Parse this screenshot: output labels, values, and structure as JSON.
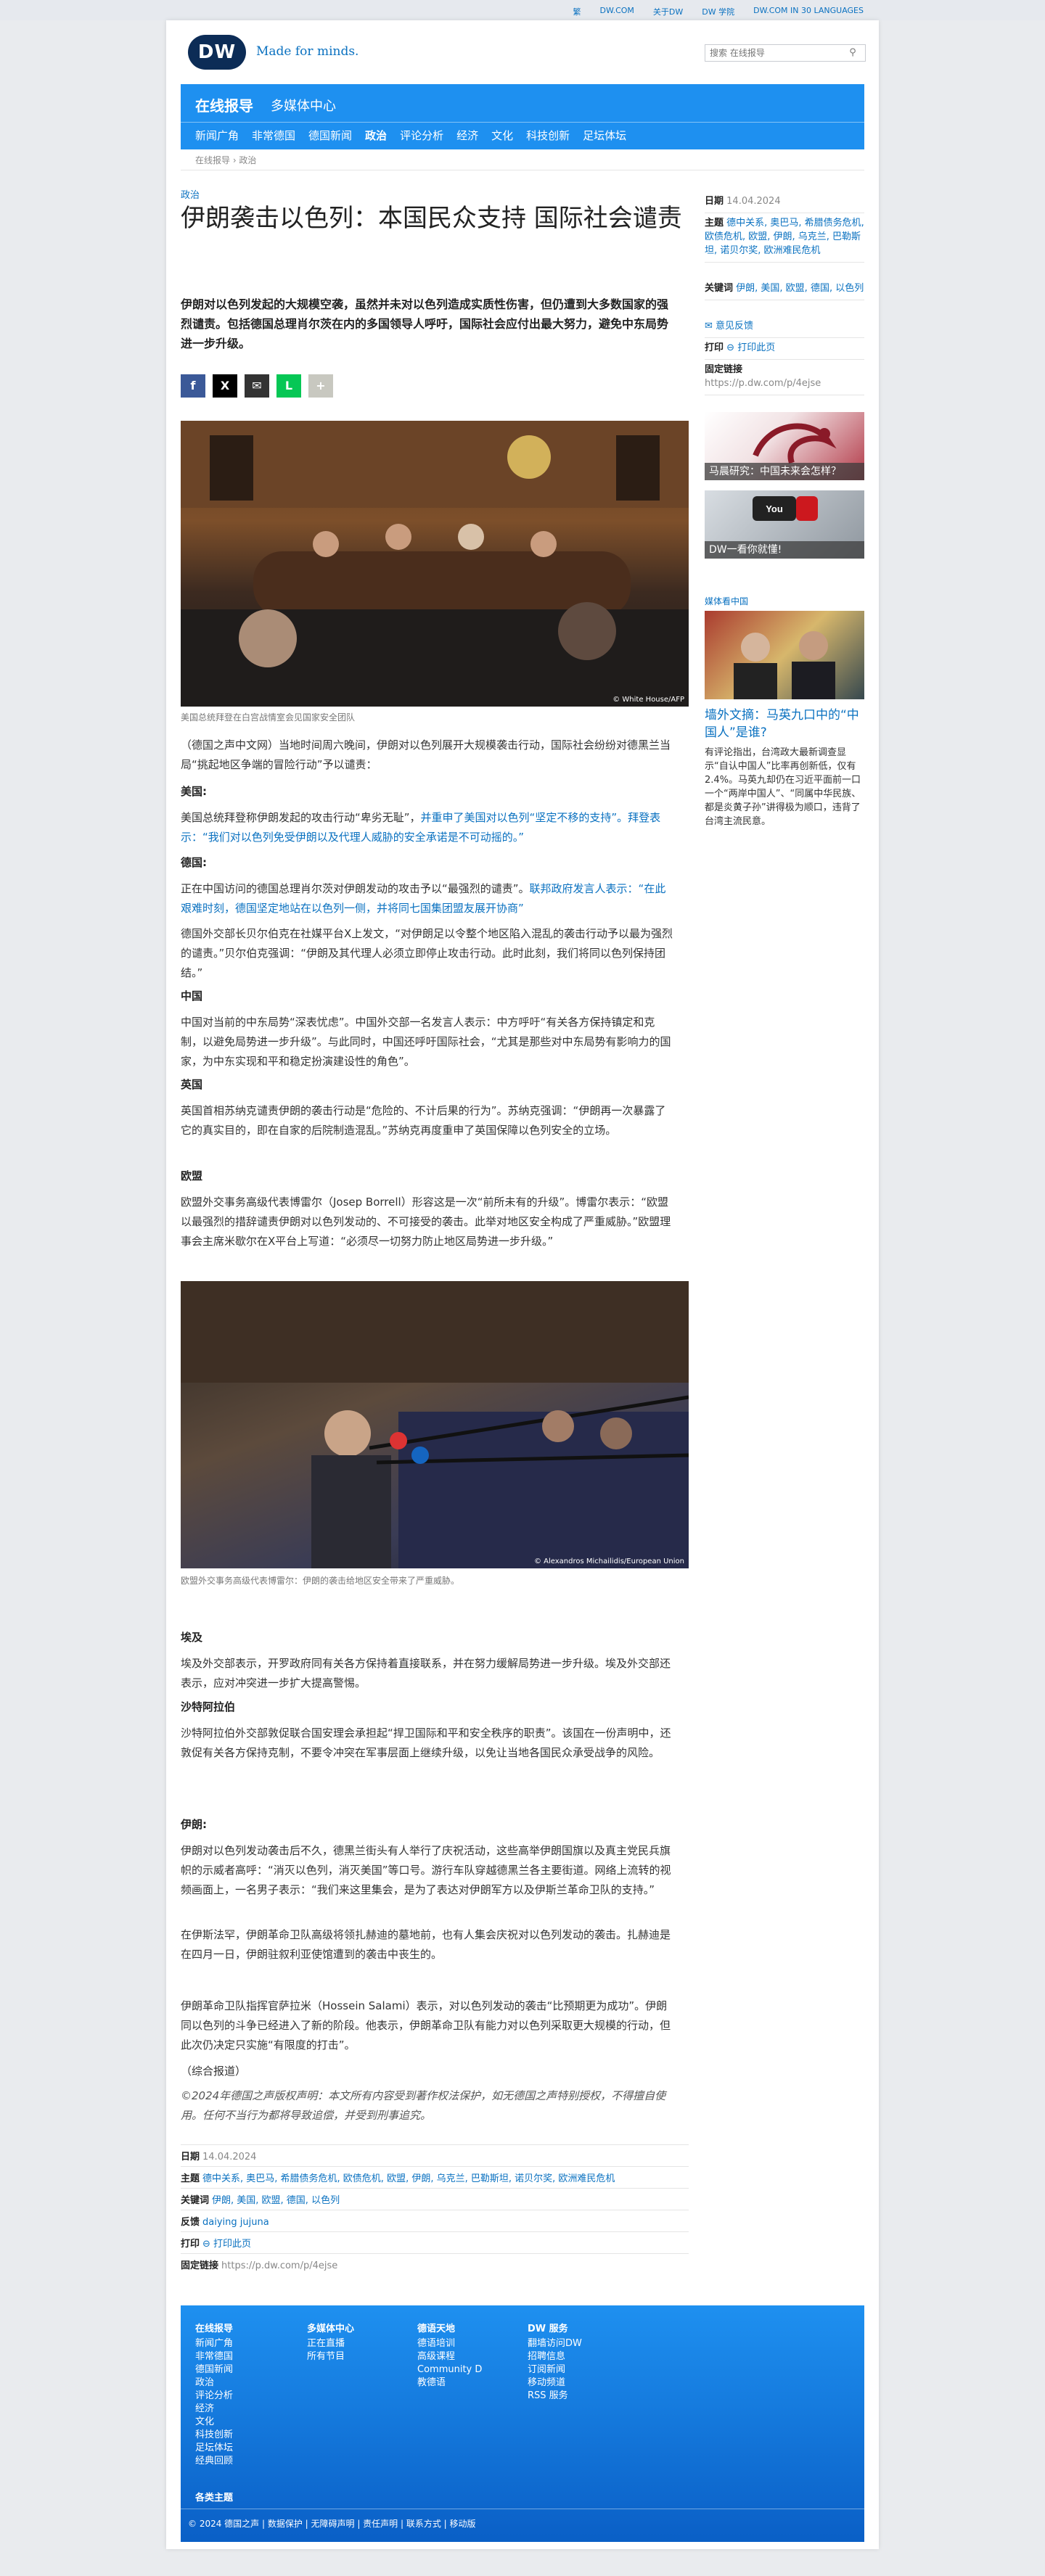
{
  "top_links": [
    "繁",
    "DW.COM",
    "关于DW",
    "DW 学院",
    "DW.COM IN 30 LANGUAGES"
  ],
  "header": {
    "logo": "DW",
    "tagline": "Made for minds.",
    "search_placeholder": "搜索 在线报导"
  },
  "nav": {
    "title": "在线报导",
    "subtitle": "多媒体中心",
    "items": [
      "新闻广角",
      "非常德国",
      "德国新闻",
      "政治",
      "评论分析",
      "经济",
      "文化",
      "科技创新",
      "足坛体坛"
    ],
    "active_index": 3
  },
  "breadcrumb": "在线报导 › 政治",
  "article": {
    "kicker": "政治",
    "headline": "伊朗袭击以色列：本国民众支持 国际社会谴责",
    "lead": "伊朗对以色列发起的大规模空袭，虽然并未对以色列造成实质性伤害，但仍遭到大多数国家的强烈谴责。包括德国总理肖尔茨在内的多国领导人呼吁，国际社会应付出最大努力，避免中东局势进一步升级。",
    "share": [
      "f",
      "X",
      "✉",
      "L",
      "+"
    ],
    "photo1_credit": "© White House/AFP",
    "photo1_caption": "美国总统拜登在白宫战情室会见国家安全团队",
    "p1": "（德国之声中文网）当地时间周六晚间，伊朗对以色列展开大规模袭击行动，国际社会纷纷对德黑兰当局“挑起地区争端的冒险行动”予以谴责：",
    "h_us": "美国:",
    "p_us_a": "美国总统拜登称伊朗发起的攻击行动“卑劣无耻”，",
    "p_us_b": "并重申了美国对以色列“坚定不移的支持”。拜登表示：“我们对以色列免受伊朗以及代理人威胁的安全承诺是不可动摇的。”",
    "h_de": "德国:",
    "p_de_a": "正在中国访问的德国总理肖尔茨对伊朗发动的攻击予以“最强烈的谴责”。",
    "p_de_b": "联邦政府发言人表示：“在此艰难时刻，德国坚定地站在以色列一侧，并将同七国集团盟友展开协商”",
    "p_de2": "德国外交部长贝尔伯克在社媒平台X上发文，“对伊朗足以令整个地区陷入混乱的袭击行动予以最为强烈的谴责。”贝尔伯克强调：“伊朗及其代理人必须立即停止攻击行动。此时此刻，我们将同以色列保持团结。”",
    "h_cn": "中国",
    "p_cn": "中国对当前的中东局势“深表忧虑”。中国外交部一名发言人表示：中方呼吁“有关各方保持镇定和克制，以避免局势进一步升级”。与此同时，中国还呼吁国际社会，“尤其是那些对中东局势有影响力的国家，为中东实现和平和稳定扮演建设性的角色”。",
    "h_uk": "英国",
    "p_uk": "英国首相苏纳克谴责伊朗的袭击行动是“危险的、不计后果的行为”。苏纳克强调：“伊朗再一次暴露了它的真实目的，即在自家的后院制造混乱。”苏纳克再度重申了英国保障以色列安全的立场。",
    "h_eu": "欧盟",
    "p_eu": "欧盟外交事务高级代表博雷尔（Josep Borrell）形容这是一次“前所未有的升级”。博雷尔表示：“欧盟以最强烈的措辞谴责伊朗对以色列发动的、不可接受的袭击。此举对地区安全构成了严重威胁。”欧盟理事会主席米歇尔在X平台上写道：“必须尽一切努力防止地区局势进一步升级。”",
    "photo2_credit": "© Alexandros Michailidis/European Union",
    "photo2_caption": "欧盟外交事务高级代表博雷尔：伊朗的袭击给地区安全带来了严重威胁。",
    "h_eg": "埃及",
    "p_eg": "埃及外交部表示，开罗政府同有关各方保持着直接联系，并在努力缓解局势进一步升级。埃及外交部还表示，应对冲突进一步扩大提高警惕。",
    "h_sa": "沙特阿拉伯",
    "p_sa": "沙特阿拉伯外交部敦促联合国安理会承担起“捍卫国际和平和安全秩序的职责”。该国在一份声明中，还敦促有关各方保持克制，不要令冲突在军事层面上继续升级，以免让当地各国民众承受战争的风险。",
    "h_ir": "伊朗:",
    "p_ir1": "伊朗对以色列发动袭击后不久，德黑兰街头有人举行了庆祝活动，这些高举伊朗国旗以及真主党民兵旗帜的示威者高呼：“消灭以色列，消灭美国”等口号。游行车队穿越德黑兰各主要街道。网络上流转的视频画面上，一名男子表示：“我们来这里集会，是为了表达对伊朗军方以及伊斯兰革命卫队的支持。”",
    "p_ir2": "在伊斯法罕，伊朗革命卫队高级将领扎赫迪的墓地前，也有人集会庆祝对以色列发动的袭击。扎赫迪是在四月一日，伊朗驻叙利亚使馆遭到的袭击中丧生的。",
    "p_ir3": "伊朗革命卫队指挥官萨拉米（Hossein Salami）表示，对以色列发动的袭击“比预期更为成功”。伊朗同以色列的斗争已经进入了新的阶段。他表示，伊朗革命卫队有能力对以色列采取更大规模的行动，但此次仍决定只实施“有限度的打击”。",
    "p_end": "（综合报道）",
    "copyright": "©2024年德国之声版权声明：本文所有内容受到著作权法保护，如无德国之声特别授权，不得擅自使用。任何不当行为都将导致追偿，并受到刑事追究。",
    "meta": {
      "date_label": "日期",
      "date": "14.04.2024",
      "topics_label": "主题",
      "topics": "德中关系, 奥巴马, 希腊债务危机, 欧债危机, 欧盟, 伊朗, 乌克兰, 巴勒斯坦, 诺贝尔奖, 欧洲难民危机",
      "keywords_label": "关键词",
      "keywords": "伊朗, 美国, 欧盟, 德国, 以色列",
      "feedback_label": "反馈",
      "feedback": "daiying jujuna",
      "print_label": "打印",
      "print": "打印此页",
      "permalink_label": "固定链接",
      "permalink": "https://p.dw.com/p/4ejse"
    }
  },
  "sidebar": {
    "date_label": "日期",
    "date": "14.04.2024",
    "topics_label": "主题",
    "topics": "德中关系, 奥巴马, 希腊债务危机, 欧债危机, 欧盟, 伊朗, 乌克兰, 巴勒斯坦, 诺贝尔奖, 欧洲难民危机",
    "keywords_label": "关键词",
    "keywords": "伊朗, 美国, 欧盟, 德国, 以色列",
    "feedback": "意见反馈",
    "print_label": "打印",
    "print": "打印此页",
    "permalink_label": "固定链接",
    "permalink": "https://p.dw.com/p/4ejse",
    "promo1": "马晨研究：中国未来会怎样？",
    "promo2": "DW一看你就懂!",
    "media_head": "媒体看中国",
    "story_title": "墙外文摘：马英九口中的“中国人”是谁?",
    "story_desc": "有评论指出，台湾政大最新调查显示“自认中国人”比率再创新低，仅有2.4%。马英九却仍在习近平面前一口一个“两岸中国人”、“同属中华民族、都是炎黄子孙”讲得极为顺口，违背了台湾主流民意。"
  },
  "footer": {
    "col1_head": "在线报导",
    "col1": [
      "新闻广角",
      "非常德国",
      "德国新闻",
      "政治",
      "评论分析",
      "经济",
      "文化",
      "科技创新",
      "足坛体坛",
      "经典回顾"
    ],
    "col2_head": "多媒体中心",
    "col2": [
      "正在直播",
      "所有节目"
    ],
    "col3_head": "德语天地",
    "col3": [
      "德语培训",
      "高级课程",
      "Community D",
      "教德语"
    ],
    "col4_head": "DW 服务",
    "col4": [
      "翻墙访问DW",
      "招聘信息",
      "订阅新闻",
      "移动频道",
      "RSS 服务"
    ],
    "topics": "各类主题",
    "bottom": "© 2024 德国之声 | 数据保护 | 无障碍声明 | 责任声明 | 联系方式 | 移动版"
  },
  "colors": {
    "brand_blue": "#1e90f0",
    "link_blue": "#0a71c0",
    "logo_navy": "#0c2c56"
  }
}
